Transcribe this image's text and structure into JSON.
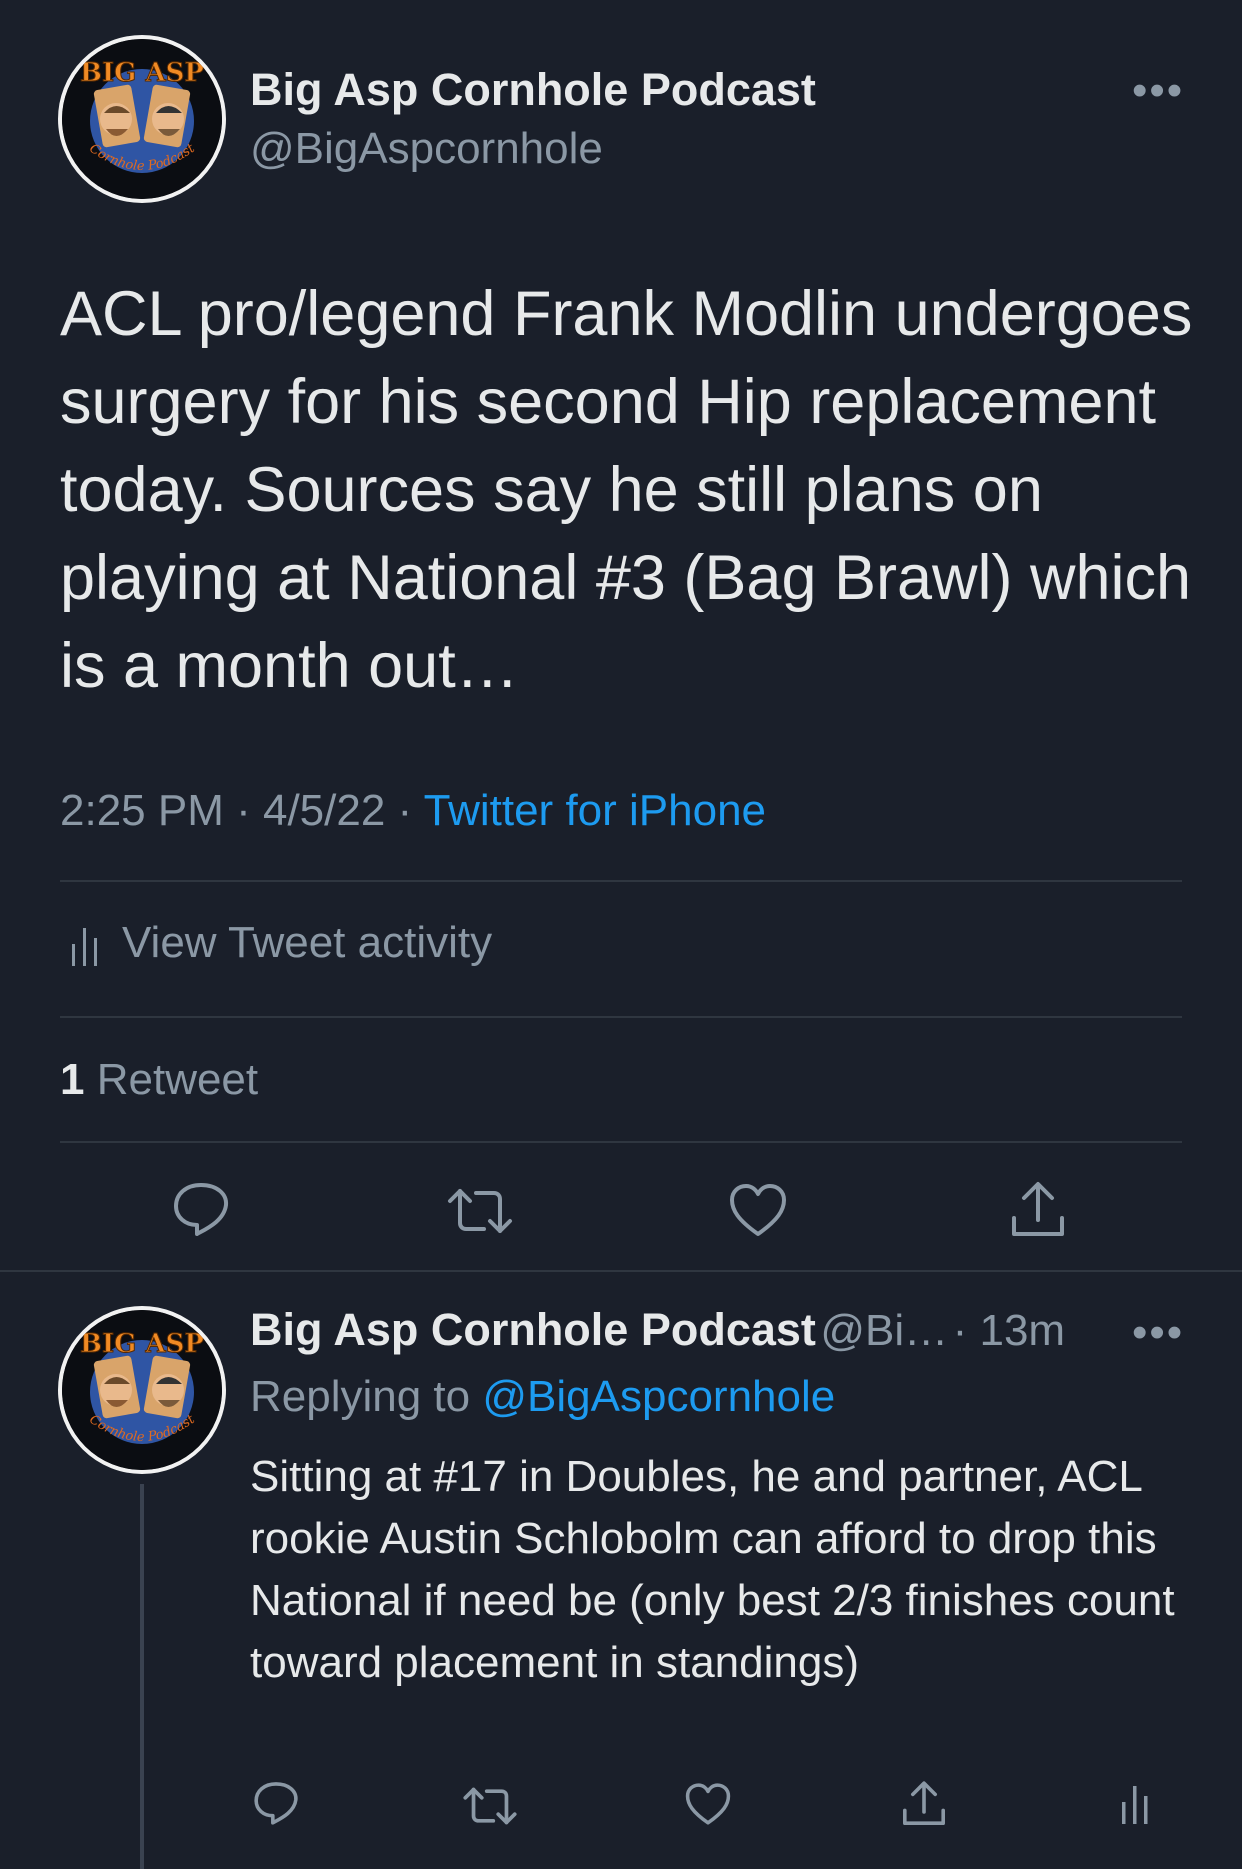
{
  "main_tweet": {
    "author_name": "Big Asp Cornhole Podcast",
    "author_handle": "@BigAspcornhole",
    "avatar_text_top": "BIG ASP",
    "avatar_text_bottom": "Cornhole Podcast",
    "text": "ACL pro/legend Frank Modlin undergoes surgery for his second Hip replacement today. Sources say he still plans on playing at National #3 (Bag Brawl) which is a month out…",
    "time": "2:25 PM",
    "separator": " · ",
    "date": "4/5/22",
    "source": "Twitter for iPhone",
    "activity_label": "View Tweet activity",
    "retweet_count": "1",
    "retweet_label": "Retweet",
    "more_label": "•••"
  },
  "reply_tweet": {
    "author_name": "Big Asp Cornhole Podcast",
    "author_handle_truncated": "@Bi…",
    "time_ago": "· 13m",
    "replying_to_prefix": "Replying to",
    "replying_to_handle": "@BigAspcornhole",
    "text": "Sitting at #17 in Doubles, he and partner, ACL rookie Austin Schlobolm can afford to drop this National if need be (only best 2/3 finishes count toward placement in standings)",
    "more_label": "•••"
  },
  "colors": {
    "background": "#1a1f2a",
    "text_primary": "#e7e9ea",
    "text_secondary": "#8b98a5",
    "link": "#1d9bf0",
    "divider": "#2f3640"
  },
  "icons": {
    "reply": "speech-bubble-icon",
    "retweet": "retweet-icon",
    "like": "heart-icon",
    "share": "share-icon",
    "analytics": "bar-chart-icon",
    "more": "more-dots-icon"
  }
}
